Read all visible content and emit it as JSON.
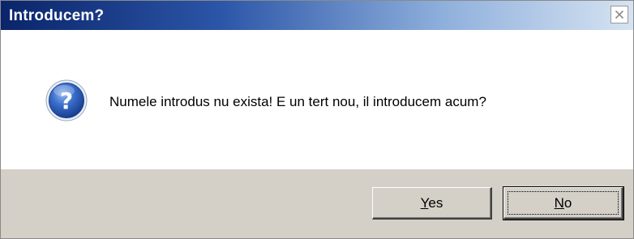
{
  "window": {
    "title": "Introducem?",
    "close_icon": "close-icon"
  },
  "message": {
    "icon": "question-icon",
    "text": "Numele introdus nu exista! E un tert nou, il introducem acum?"
  },
  "buttons": {
    "yes": {
      "accel": "Y",
      "rest": "es",
      "label": "Yes"
    },
    "no": {
      "accel": "N",
      "rest": "o",
      "label": "No",
      "focused": true
    }
  },
  "colors": {
    "titlebar_start": "#0a246a",
    "titlebar_end": "#d6e3f2",
    "footer_bg": "#d4d0c8",
    "icon_blue": "#2a5fb8"
  }
}
